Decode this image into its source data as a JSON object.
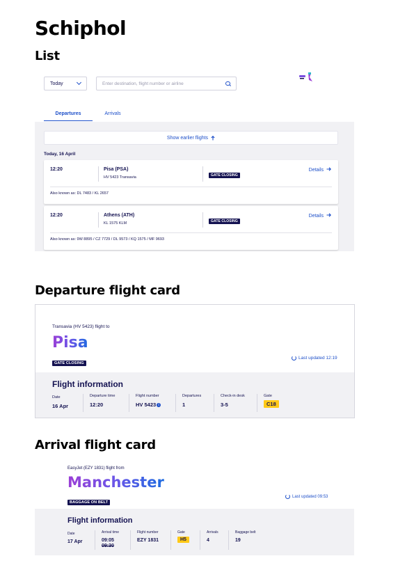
{
  "page": {
    "title": "Schiphol",
    "section_list": "List",
    "section_departure": "Departure flight card",
    "section_arrival": "Arrival flight card"
  },
  "filters": {
    "date_value": "Today",
    "search_placeholder": "Enter destination, flight number or airline"
  },
  "tabs": [
    {
      "label": "Departures",
      "active": true
    },
    {
      "label": "Arrivals",
      "active": false
    }
  ],
  "list": {
    "show_earlier": "Show earlier flights",
    "day_label": "Today, 16 April",
    "flights": [
      {
        "time": "12:20",
        "destination": "Pisa (PSA)",
        "flight_line": "HV 5423 Transavia",
        "status": "GATE CLOSING",
        "details": "Details",
        "also_known": "Also known as: DL 7483 / KL 2657"
      },
      {
        "time": "12:20",
        "destination": "Athens (ATH)",
        "flight_line": "KL 1575 KLM",
        "status": "GATE CLOSING",
        "details": "Details",
        "also_known": "Also known as: 9W 8895 / CZ 7729 / DL 9573 / KQ 1575 / MF 9693"
      }
    ]
  },
  "departure_card": {
    "intro": "Transavia (HV 5423) flight to",
    "destination": "Pisa",
    "status": "GATE CLOSING",
    "last_updated": "Last updated 12:19",
    "info_title": "Flight information",
    "fields": [
      {
        "label": "Date",
        "value": "16 Apr"
      },
      {
        "label": "Departure time",
        "value": "12:20"
      },
      {
        "label": "Flight number",
        "value": "HV 5423"
      },
      {
        "label": "Departures",
        "value": "1"
      },
      {
        "label": "Check-in desk",
        "value": "3-5"
      },
      {
        "label": "Gate",
        "value": "C18"
      }
    ]
  },
  "arrival_card": {
    "intro": "EasyJet (EZY 1831) flight from",
    "origin": "Manchester",
    "status": "BAGGAGE ON BELT",
    "last_updated": "Last updated 09:53",
    "info_title": "Flight information",
    "fields": [
      {
        "label": "Date",
        "value": "17 Apr"
      },
      {
        "label": "Arrival time",
        "value": "09:05",
        "old_value": "09:30"
      },
      {
        "label": "Flight number",
        "value": "EZY 1831"
      },
      {
        "label": "Gate",
        "value": "H5"
      },
      {
        "label": "Arrivals",
        "value": "4"
      },
      {
        "label": "Baggage belt",
        "value": "19"
      }
    ]
  },
  "colors": {
    "brand_navy": "#141251",
    "link_blue": "#1d4fc9",
    "gate_yellow": "#ffc917",
    "panel_gray": "#f1f1f4"
  },
  "icons": {
    "dropdown": "chevron-down-icon",
    "search": "search-icon",
    "arrow_up": "arrow-up-icon",
    "arrow_right": "arrow-right-icon",
    "refresh": "refresh-icon",
    "info": "info-icon",
    "decorative": "travel-illustration-icon"
  }
}
